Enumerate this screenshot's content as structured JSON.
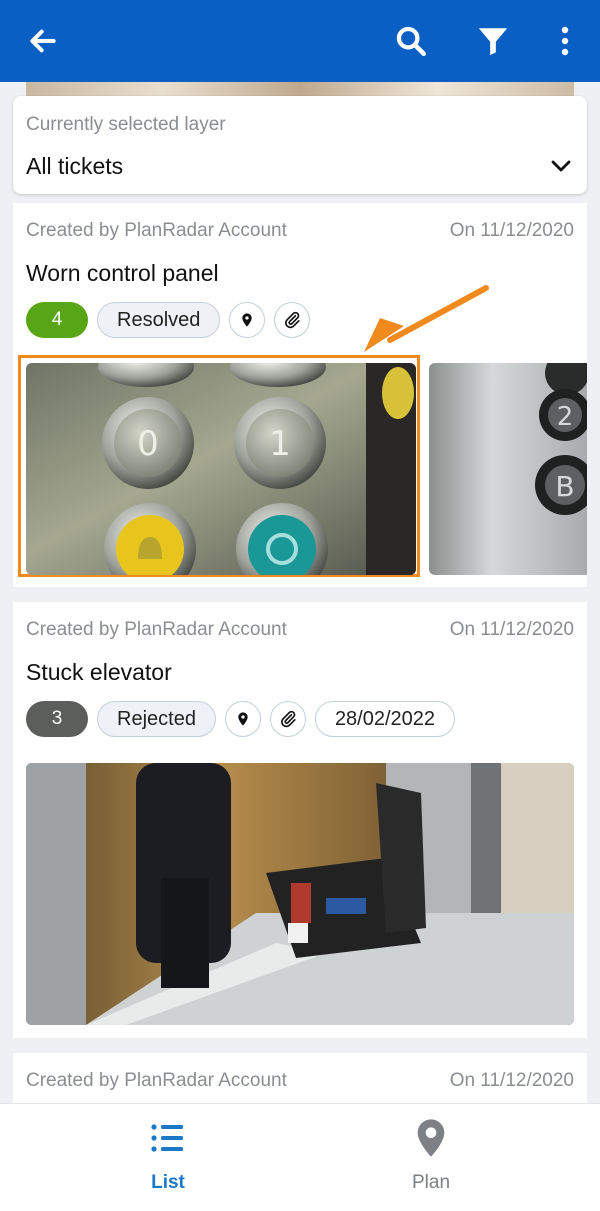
{
  "appbar": {
    "back_icon": "arrow-left-icon",
    "actions": [
      "search-icon",
      "filter-icon",
      "more-vertical-icon"
    ],
    "color": "#0a5fc4"
  },
  "layer_selector": {
    "caption": "Currently selected layer",
    "value": "All tickets"
  },
  "tickets": [
    {
      "creator": "Created by PlanRadar Account",
      "date": "On 11/12/2020",
      "title": "Worn control panel",
      "priority": "4",
      "priority_color": "#58a618",
      "status": "Resolved",
      "has_location": true,
      "has_attachment": true,
      "photos": [
        "elevator-buttons-photo",
        "elevator-floor-buttons-photo"
      ],
      "highlighted": true
    },
    {
      "creator": "Created by PlanRadar Account",
      "date": "On 11/12/2020",
      "title": "Stuck elevator",
      "priority": "3",
      "priority_color": "#5b5e5a",
      "status": "Rejected",
      "has_location": true,
      "has_attachment": true,
      "due_date": "28/02/2022",
      "photos": [
        "elevator-repair-photo"
      ]
    },
    {
      "creator": "Created by PlanRadar Account",
      "date": "On 11/12/2020"
    }
  ],
  "highlight_color": "#f08a1c",
  "bottom_nav": [
    {
      "label": "List",
      "icon": "list-icon",
      "active": true
    },
    {
      "label": "Plan",
      "icon": "map-pin-icon",
      "active": false
    }
  ]
}
